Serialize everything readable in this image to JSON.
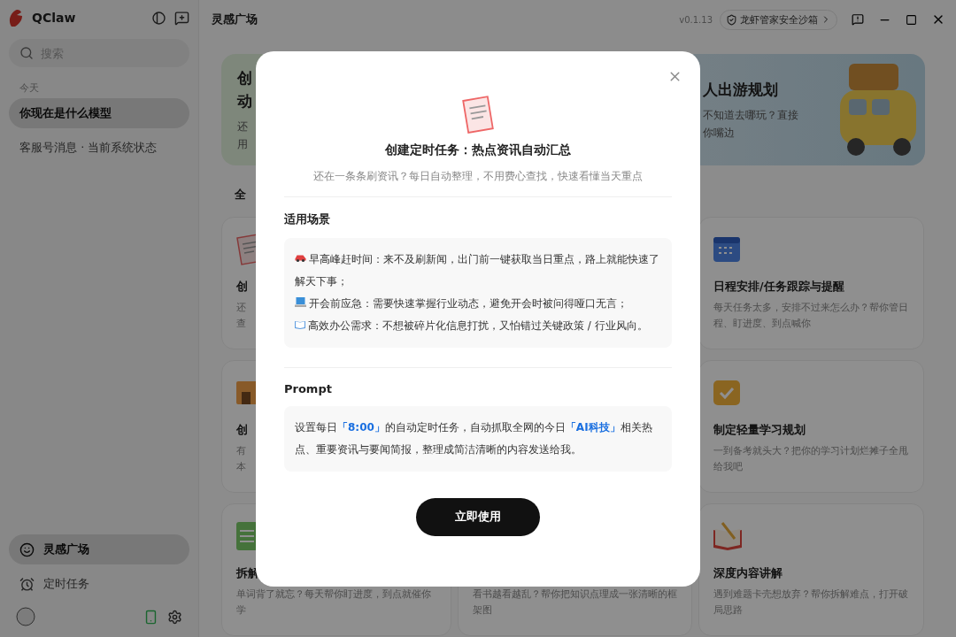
{
  "sidebar": {
    "app_name": "QClaw",
    "search": {
      "placeholder": "搜索"
    },
    "history_group": "今天",
    "history": [
      {
        "label": "你现在是什么模型",
        "selected": true
      },
      {
        "label": "客服号消息 · 当前系统状态",
        "selected": false
      }
    ],
    "nav": [
      {
        "label": "灵感广场",
        "selected": true,
        "kind": "inspiration"
      },
      {
        "label": "定时任务",
        "selected": false,
        "kind": "schedule"
      }
    ]
  },
  "header": {
    "title": "灵感广场",
    "version": "v0.1.13",
    "sandbox": "龙虾管家安全沙箱"
  },
  "banners": [
    {
      "lines": [
        "创",
        "动"
      ],
      "desc": [
        "还",
        "用"
      ],
      "kind": "green"
    },
    {
      "lines": [
        "人出游规划"
      ],
      "desc": [
        "不知道去哪玩？直接",
        "你嘴边"
      ],
      "kind": "blue"
    }
  ],
  "filter_tab": "全",
  "card_columns": [
    [
      {
        "title": "创",
        "desc": [
          "还",
          "查"
        ],
        "kind": "news"
      },
      {
        "title": "创",
        "desc": [
          "有",
          "本"
        ],
        "kind": "shop"
      },
      {
        "title": "拆解",
        "desc": [
          "单词背了就忘？每天帮你盯进度，到点就催你",
          "学"
        ],
        "kind": "sheet"
      }
    ],
    [
      {
        "desc": [
          "看书越看越乱？帮你把知识点理成一张清晰的框",
          "架图"
        ],
        "kind": "none"
      }
    ],
    [
      {
        "title": "日程安排/任务跟踪与提醒",
        "desc": [
          "每天任务太多，安排不过来怎么办？帮你管日",
          "程、盯进度、到点喊你"
        ],
        "kind": "calendar"
      },
      {
        "title": "制定轻量学习规划",
        "desc": [
          "一到备考就头大？把你的学习计划烂摊子全甩",
          "给我吧"
        ],
        "kind": "checklist"
      },
      {
        "title": "深度内容讲解",
        "desc": [
          "遇到难题卡壳想放弃？帮你拆解难点，打开破",
          "局思路"
        ],
        "kind": "book"
      }
    ]
  ],
  "modal": {
    "title": "创建定时任务：热点资讯自动汇总",
    "subtitle": "还在一条条刷资讯？每日自动整理，不用费心查找，快速看懂当天重点",
    "scenario_heading": "适用场景",
    "scenarios": [
      {
        "kind": "car",
        "text": "早高峰赶时间：来不及刷新闻，出门前一键获取当日重点，路上就能快速了解天下事；"
      },
      {
        "kind": "laptop",
        "text": "开会前应急：需要快速掌握行业动态，避免开会时被问得哑口无言；"
      },
      {
        "kind": "book",
        "text": "高效办公需求：不想被碎片化信息打扰，又怕错过关键政策 / 行业风向。"
      }
    ],
    "prompt_heading": "Prompt",
    "prompt": [
      {
        "text": "设置每日",
        "highlight": false
      },
      {
        "text": "「8:00」",
        "highlight": true
      },
      {
        "text": "的自动定时任务，自动抓取全网的今日",
        "highlight": false
      },
      {
        "text": "「AI科技」",
        "highlight": true
      },
      {
        "text": "相关热点、重要资讯与要闻简报，整理成简洁清晰的内容发送给我。",
        "highlight": false
      }
    ],
    "button": "立即使用"
  }
}
